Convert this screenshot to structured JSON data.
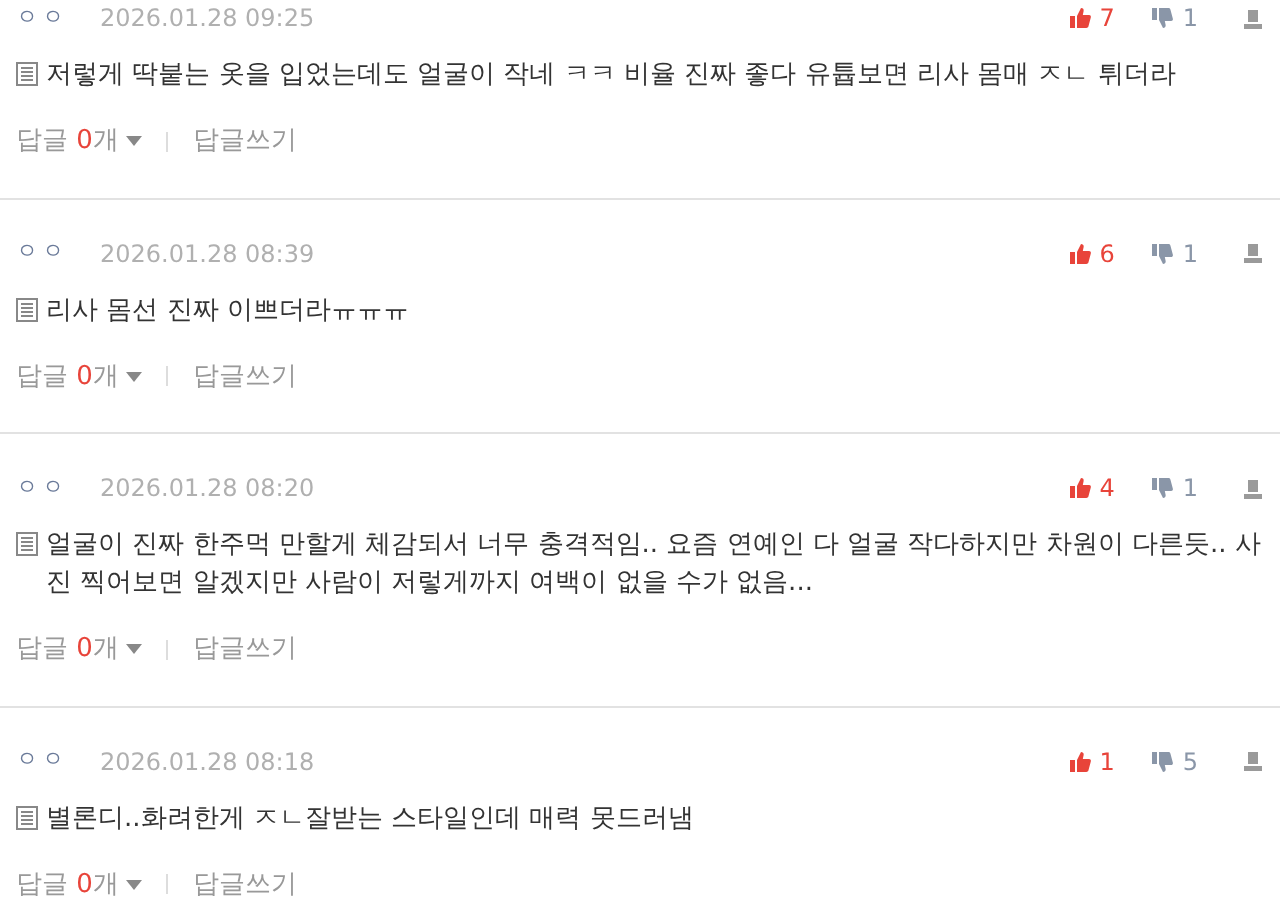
{
  "comments": [
    {
      "author": "ㅇㅇ",
      "date": "2026.01.28 09:25",
      "likes": "7",
      "dislikes": "1",
      "text": "저렇게 딱붙는 옷을 입었는데도 얼굴이 작네 ㅋㅋ 비율 진짜 좋다 유튭보면 리사 몸매 ㅈㄴ 튀더라",
      "reply_label": "답글",
      "reply_count": "0",
      "reply_unit": "개",
      "write_reply": "답글쓰기"
    },
    {
      "author": "ㅇㅇ",
      "date": "2026.01.28 08:39",
      "likes": "6",
      "dislikes": "1",
      "text": "리사 몸선 진짜 이쁘더라ㅠㅠㅠ",
      "reply_label": "답글",
      "reply_count": "0",
      "reply_unit": "개",
      "write_reply": "답글쓰기"
    },
    {
      "author": "ㅇㅇ",
      "date": "2026.01.28 08:20",
      "likes": "4",
      "dislikes": "1",
      "text": "얼굴이 진짜 한주먹 만할게 체감되서 너무 충격적임.. 요즘 연예인 다 얼굴 작다하지만 차원이 다른듯.. 사진 찍어보면 알겠지만 사람이 저렇게까지 여백이 없을 수가 없음...",
      "reply_label": "답글",
      "reply_count": "0",
      "reply_unit": "개",
      "write_reply": "답글쓰기"
    },
    {
      "author": "ㅇㅇ",
      "date": "2026.01.28 08:18",
      "likes": "1",
      "dislikes": "5",
      "text": "별론디..화려한게 ㅈㄴ잘받는 스타일인데 매력 못드러냄",
      "reply_label": "답글",
      "reply_count": "0",
      "reply_unit": "개",
      "write_reply": "답글쓰기"
    }
  ]
}
